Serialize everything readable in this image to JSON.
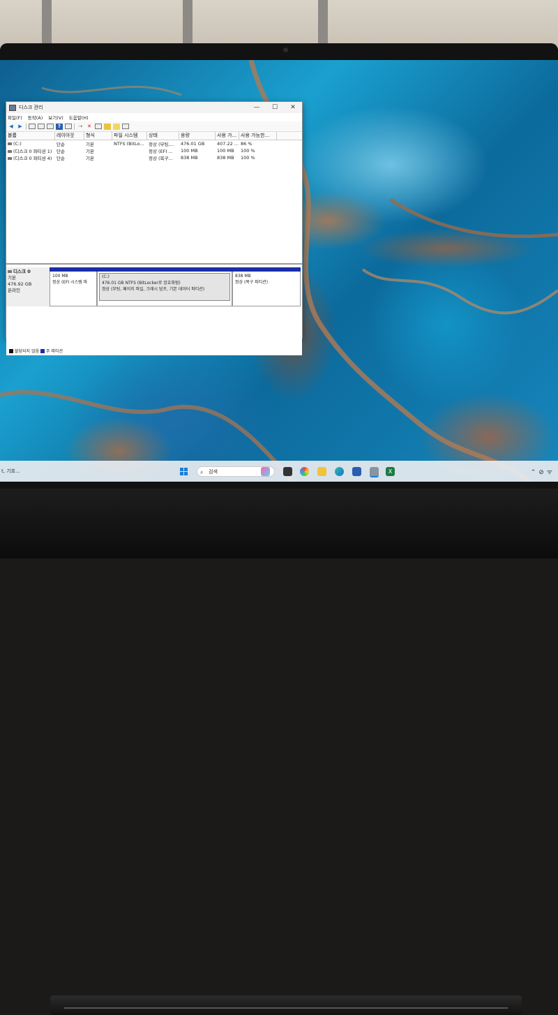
{
  "window": {
    "title": "디스크 관리",
    "menu": [
      "파일(F)",
      "동작(A)",
      "보기(V)",
      "도움말(H)"
    ],
    "controls": {
      "minimize": "—",
      "maximize": "☐",
      "close": "✕"
    }
  },
  "volume_list": {
    "headers": [
      "볼륨",
      "레이아웃",
      "형식",
      "파일 시스템",
      "상태",
      "용량",
      "사용 가...",
      "사용 가능한..."
    ],
    "rows": [
      {
        "volume": "(C:)",
        "layout": "단순",
        "type": "기본",
        "fs": "NTFS (BitLo...",
        "status": "정상 (부팅,...",
        "capacity": "476.01 GB",
        "free": "407.22 ...",
        "pct": "86 %"
      },
      {
        "volume": "(디스크 0 파티션 1)",
        "layout": "단순",
        "type": "기본",
        "fs": "",
        "status": "정상 (EFI ...",
        "capacity": "100 MB",
        "free": "100 MB",
        "pct": "100 %"
      },
      {
        "volume": "(디스크 0 파티션 4)",
        "layout": "단순",
        "type": "기본",
        "fs": "",
        "status": "정상 (복구...",
        "capacity": "838 MB",
        "free": "838 MB",
        "pct": "100 %"
      }
    ]
  },
  "disk": {
    "name": "디스크 0",
    "type": "기본",
    "size": "476.92 GB",
    "status": "온라인",
    "partitions": [
      {
        "line1": "100 MB",
        "line2": "정상 (EFI 시스템 파"
      },
      {
        "label": "(C:)",
        "line1": "476.01 GB NTFS (BitLocker로 암호화됨)",
        "line2": "정상 (부팅, 페이지 파일, 크래시 덤프, 기본 데이터 파티션)"
      },
      {
        "line1": "838 MB",
        "line2": "정상 (복구 파티션)"
      }
    ]
  },
  "legend": {
    "unallocated": "할당되지 않음",
    "primary": "주 파티션"
  },
  "colors": {
    "primary_partition": "#1a2ea8",
    "unallocated": "#111111",
    "accent": "#1a7fd6"
  },
  "taskbar": {
    "left_text": "t, 기호...",
    "search_placeholder": "검색",
    "icons": [
      "windows-start",
      "search",
      "copilot",
      "task-view",
      "edge-colorful",
      "file-explorer",
      "edge",
      "store",
      "disk-management",
      "excel"
    ]
  }
}
